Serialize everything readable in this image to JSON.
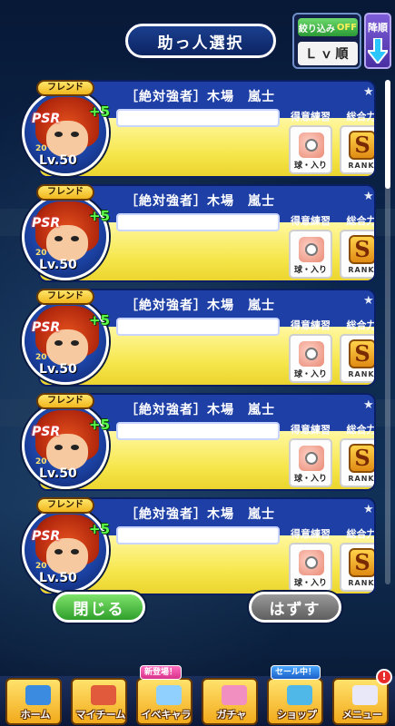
{
  "header": {
    "title": "助っ人選択",
    "filter": {
      "label": "絞り込み",
      "state": "OFF",
      "sort_value": "Ｌｖ順"
    },
    "sort_order_label": "降順"
  },
  "cards": [
    {
      "badge": "フレンド",
      "bonus": "+5",
      "name": "［絶対強者］木場　嵐士",
      "level": "Lv.50",
      "logo": "PSR",
      "small_number": "20",
      "skill_label": "得意練習",
      "skill_value": "球・入り",
      "rank_label": "総合力",
      "rank_value": "S",
      "rank_sub": "RANK"
    },
    {
      "badge": "フレンド",
      "bonus": "+5",
      "name": "［絶対強者］木場　嵐士",
      "level": "Lv.50",
      "logo": "PSR",
      "small_number": "20",
      "skill_label": "得意練習",
      "skill_value": "球・入り",
      "rank_label": "総合力",
      "rank_value": "S",
      "rank_sub": "RANK"
    },
    {
      "badge": "フレンド",
      "bonus": "+5",
      "name": "［絶対強者］木場　嵐士",
      "level": "Lv.50",
      "logo": "PSR",
      "small_number": "20",
      "skill_label": "得意練習",
      "skill_value": "球・入り",
      "rank_label": "総合力",
      "rank_value": "S",
      "rank_sub": "RANK"
    },
    {
      "badge": "フレンド",
      "bonus": "+5",
      "name": "［絶対強者］木場　嵐士",
      "level": "Lv.50",
      "logo": "PSR",
      "small_number": "20",
      "skill_label": "得意練習",
      "skill_value": "球・入り",
      "rank_label": "総合力",
      "rank_value": "S",
      "rank_sub": "RANK"
    },
    {
      "badge": "フレンド",
      "bonus": "+5",
      "name": "［絶対強者］木場　嵐士",
      "level": "Lv.50",
      "logo": "PSR",
      "small_number": "20",
      "skill_label": "得意練習",
      "skill_value": "球・入り",
      "rank_label": "総合力",
      "rank_value": "S",
      "rank_sub": "RANK"
    }
  ],
  "buttons": {
    "close": "閉じる",
    "remove": "はずす"
  },
  "nav": [
    {
      "label": "ホーム",
      "icon": "home-icon",
      "badge": ""
    },
    {
      "label": "マイチーム",
      "icon": "team-icon",
      "badge": ""
    },
    {
      "label": "イベキャラ",
      "icon": "event-character-icon",
      "badge": "新登場！"
    },
    {
      "label": "ガチャ",
      "icon": "gacha-icon",
      "badge": ""
    },
    {
      "label": "ショップ",
      "icon": "shop-icon",
      "badge": "セール中！"
    },
    {
      "label": "メニュー",
      "icon": "menu-icon",
      "badge": "",
      "alert": "!"
    }
  ],
  "colors": {
    "accent": "#1d3fa6",
    "card_yellow": "#f6e64a",
    "close_green": "#2f9f2b"
  }
}
